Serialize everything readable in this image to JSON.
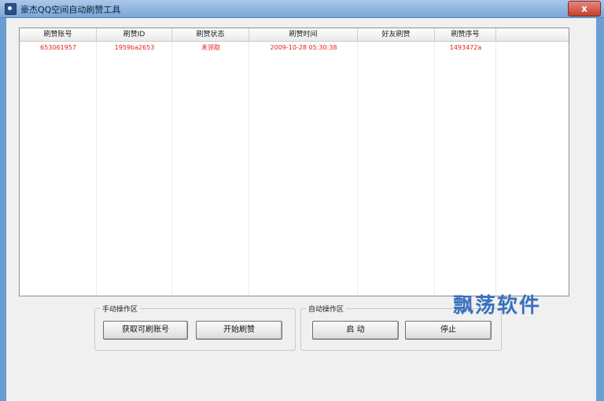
{
  "window": {
    "title": "豪杰QQ空间自动刷赞工具",
    "close_label": "x"
  },
  "table": {
    "columns": [
      "刷赞账号",
      "刷赞ID",
      "刷赞状态",
      "刷赞时间",
      "好友刷赞",
      "刷赞序号"
    ],
    "rows": [
      [
        "653061957",
        "1959ba2653",
        "未领取",
        "2009-10-28 05:30:38",
        "",
        "1493472a"
      ]
    ]
  },
  "manual_group": {
    "title": "手动操作区",
    "get_accounts_label": "获取可刷账号",
    "start_label": "开始刷赞"
  },
  "auto_group": {
    "title": "自动操作区",
    "launch_label": "启 动",
    "stop_label": "停止"
  },
  "watermark": "飘荡软件"
}
